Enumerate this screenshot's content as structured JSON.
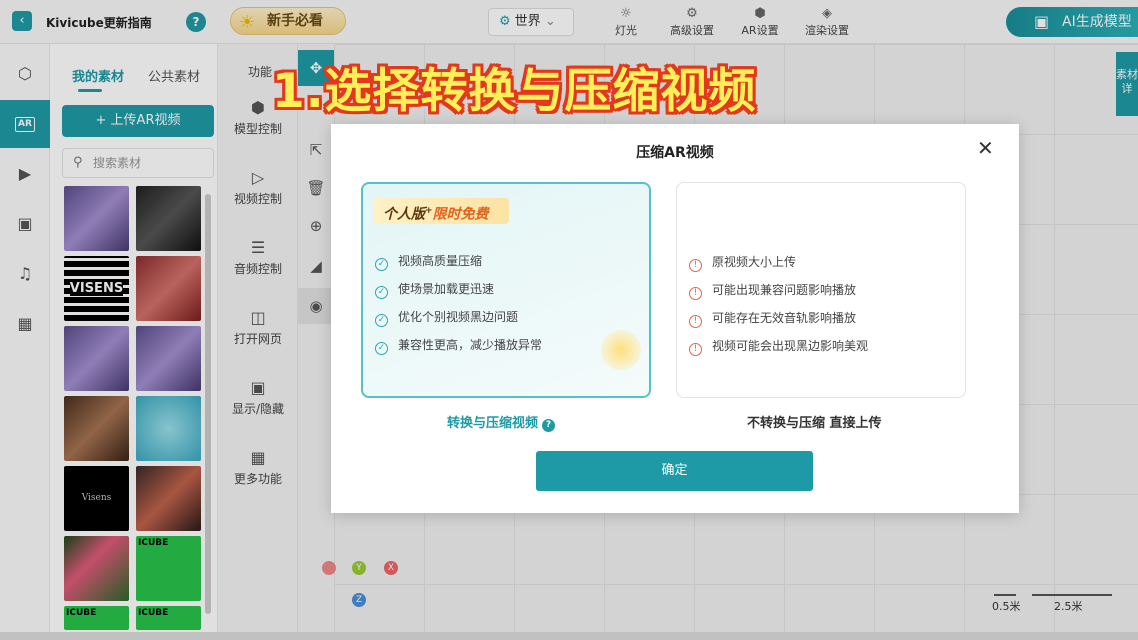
{
  "header": {
    "title": "Kivicube更新指南",
    "help": "?",
    "newbie_label": "新手必看",
    "world_label": "世界",
    "tools": [
      {
        "label": "灯光",
        "icon": "sun-icon"
      },
      {
        "label": "高级设置",
        "icon": "gear-icon"
      },
      {
        "label": "AR设置",
        "icon": "ar-settings-icon"
      },
      {
        "label": "渲染设置",
        "icon": "paint-bucket-icon"
      }
    ],
    "ai_label": "AI生成模型"
  },
  "assets": {
    "tab_mine": "我的素材",
    "tab_public": "公共素材",
    "upload_label": "上传AR视频",
    "search_placeholder": "搜索素材",
    "thumb_texts": [
      "VISENS",
      "Visens",
      "ICUBE",
      "ICUBE",
      "ICUBE"
    ]
  },
  "functions": {
    "header": "功能",
    "items": [
      "模型控制",
      "视频控制",
      "音频控制",
      "打开网页",
      "显示/隐藏",
      "更多功能"
    ]
  },
  "side_tab": "素材详",
  "scale": {
    "a": "0.5米",
    "b": "2.5米"
  },
  "gizmo": {
    "y": "Y",
    "x": "X",
    "z": "Z"
  },
  "caption": "1.选择转换与压缩视频",
  "modal": {
    "title": "压缩AR视频",
    "badge_main": "个人版",
    "badge_sup": "+",
    "badge_free": "限时免费",
    "pros": [
      "视频高质量压缩",
      "使场景加载更迅速",
      "优化个别视频黑边问题",
      "兼容性更高，减少播放异常"
    ],
    "cons": [
      "原视频大小上传",
      "可能出现兼容问题影响播放",
      "可能存在无效音轨影响播放",
      "视频可能会出现黑边影响美观"
    ],
    "option_left": "转换与压缩视频",
    "option_right": "不转换与压缩 直接上传",
    "confirm": "确定"
  }
}
